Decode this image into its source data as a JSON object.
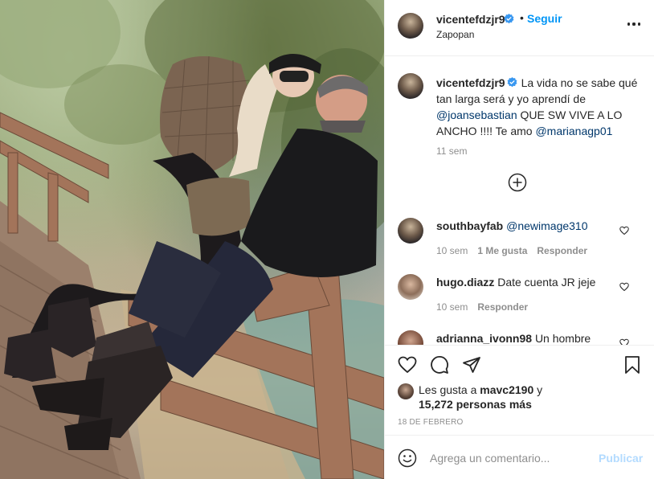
{
  "post": {
    "username": "vicentefdzjr9",
    "follow_separator": "•",
    "follow_label": "Seguir",
    "location": "Zapopan",
    "photo_subject": "couple-on-wooden-bridge"
  },
  "caption": {
    "username": "vicentefdzjr9",
    "text_1": "La vida no se sabe qué tan larga será y yo aprendí de ",
    "mention_1": "@joansebastian",
    "text_2": " QUE SW VIVE A LO ANCHO !!!! Te amo ",
    "mention_2": "@marianagp01",
    "time": "11 sem"
  },
  "comments": [
    {
      "username": "southbayfab",
      "mention": "@newimage310",
      "text": "",
      "time": "10 sem",
      "likes": "1 Me gusta",
      "reply": "Responder"
    },
    {
      "username": "hugo.diazz",
      "mention": "",
      "text": "Date cuenta JR jeje",
      "time": "10 sem",
      "likes": "",
      "reply": "Responder"
    },
    {
      "username": "adrianna_ivonn98",
      "mention": "",
      "text": "Un hombre",
      "time": "",
      "likes": "",
      "reply": ""
    }
  ],
  "likes": {
    "prefix": "Les gusta a ",
    "user": "mavc2190",
    "middle": " y ",
    "count": "15,272 personas más"
  },
  "date": "18 DE FEBRERO",
  "input": {
    "placeholder": "Agrega un comentario...",
    "value": ""
  },
  "publish_label": "Publicar",
  "colors": {
    "link": "#0095f6",
    "mention": "#00376b",
    "muted": "#8e8e8e",
    "verified": "#3897f0",
    "publish_disabled": "#b3dbff"
  },
  "icons": [
    "verified-badge-icon",
    "more-options-icon",
    "plus-circle-icon",
    "heart-icon",
    "comment-icon",
    "share-icon",
    "bookmark-icon",
    "emoji-icon"
  ]
}
